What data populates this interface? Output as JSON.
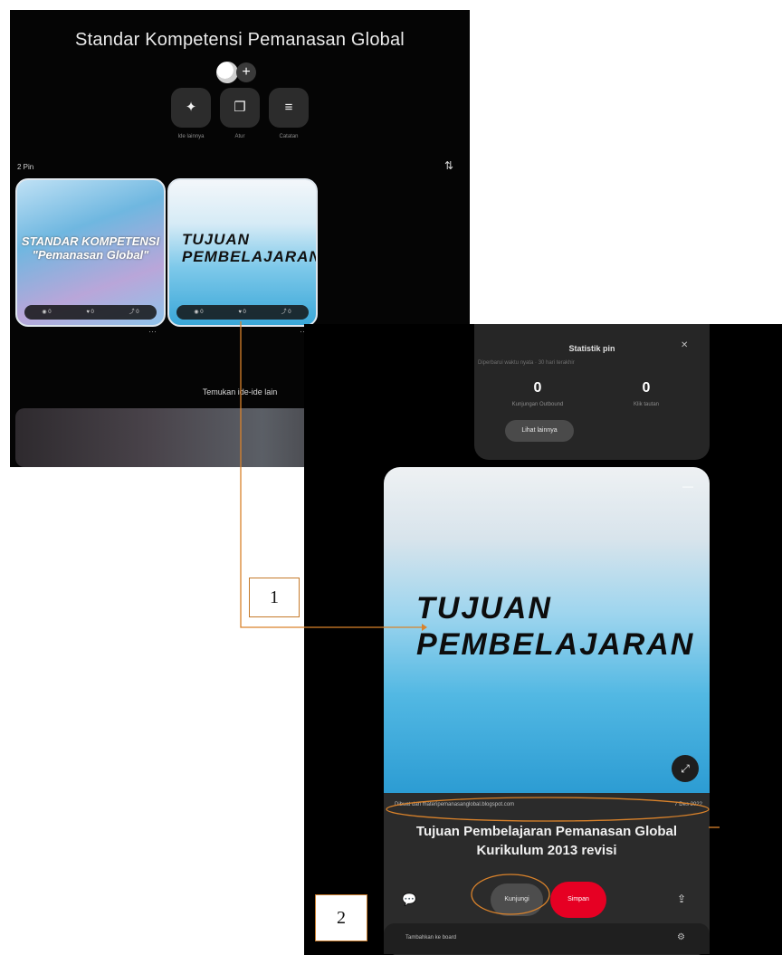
{
  "board": {
    "title": "Standar Kompetensi Pemanasan Global",
    "add_collaborator": "+",
    "actions": [
      {
        "icon": "✦",
        "label": "Ide lainnya"
      },
      {
        "icon": "❐",
        "label": "Atur"
      },
      {
        "icon": "≡",
        "label": "Catatan"
      }
    ],
    "pin_count": "2 Pin",
    "filter_icon": "⇅",
    "pins": [
      {
        "text": "STANDAR KOMPETENSI \"Pemanasan Global\"",
        "stats": [
          "◉ 0",
          "♥ 0",
          "⤴ 0"
        ]
      },
      {
        "text": "TUJUAN PEMBELAJARAN",
        "stats": [
          "◉ 0",
          "♥ 0",
          "⤴ 0"
        ]
      }
    ],
    "more_icon": "⋯",
    "discover_text": "Temukan ide-ide lain"
  },
  "detail": {
    "stats": {
      "title": "Statistik pin",
      "subtitle": "Diperbarui waktu nyata · 30 hari terakhir",
      "close_icon": "✕",
      "metrics": [
        {
          "value": "0",
          "label": "Kunjungan Outbound"
        },
        {
          "value": "0",
          "label": "Klik tautan"
        }
      ],
      "button": "Lihat lainnya"
    },
    "close_icon": "—",
    "image_text": "TUJUAN PEMBELAJARAN",
    "expand_icon": "⤢",
    "source": "Dibuat dari materipemanasanglobal.blogspot.com",
    "date": "7 Des 2022",
    "title": "Tujuan Pembelajaran Pemanasan Global Kurikulum 2013 revisi",
    "comment_icon": "💬",
    "visit_button": "Kunjungi",
    "save_button": "Simpan",
    "share_icon": "⇪",
    "board_row_label": "Tambahkan ke board",
    "board_row_icon": "⚙"
  },
  "annotations": {
    "marker1": "1",
    "marker2": "2",
    "line_color": "#d9822b"
  }
}
